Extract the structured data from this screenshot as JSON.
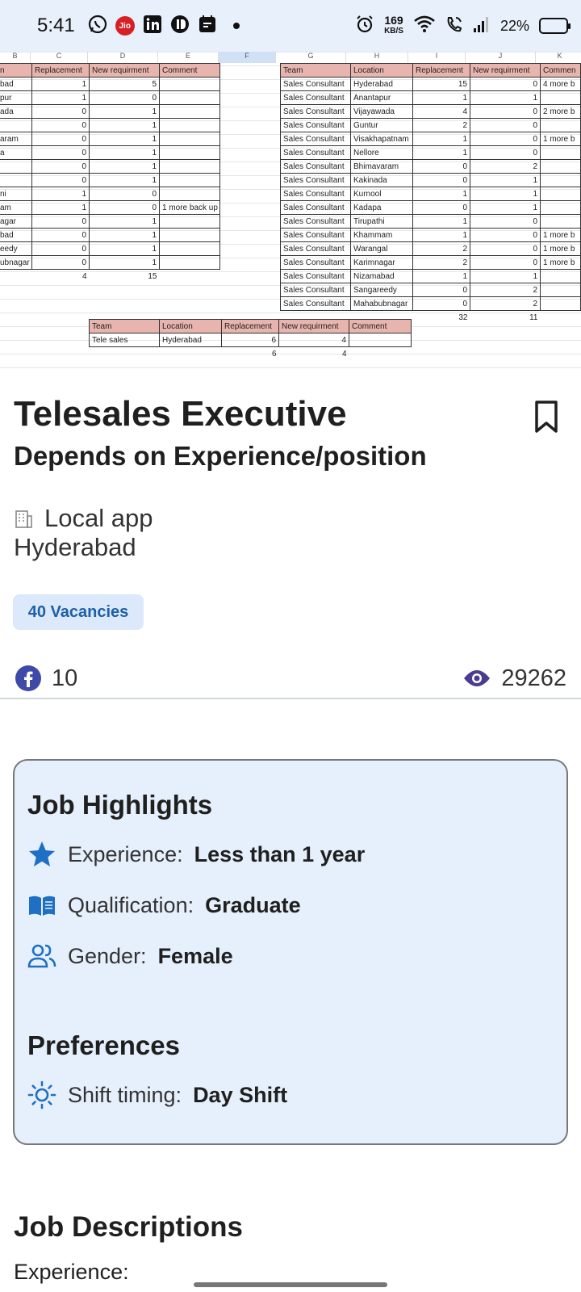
{
  "status_bar": {
    "time": "5:41",
    "jio_label": "Jio",
    "speed_value": "169",
    "speed_unit": "KB/S",
    "battery": "22%"
  },
  "sheet": {
    "col_letters_left": [
      "B",
      "C",
      "D",
      "E",
      "F"
    ],
    "col_letters_right": [
      "G",
      "H",
      "I",
      "J",
      "K"
    ],
    "left_table": {
      "headers": [
        "n",
        "Replacement",
        "New requirment",
        "Comment"
      ],
      "rows": [
        [
          "bad",
          "1",
          "5",
          ""
        ],
        [
          "pur",
          "1",
          "0",
          ""
        ],
        [
          "ada",
          "0",
          "1",
          ""
        ],
        [
          "",
          "0",
          "1",
          ""
        ],
        [
          "aram",
          "0",
          "1",
          ""
        ],
        [
          "a",
          "0",
          "1",
          ""
        ],
        [
          "",
          "0",
          "1",
          ""
        ],
        [
          "",
          "0",
          "1",
          ""
        ],
        [
          "ni",
          "1",
          "0",
          ""
        ],
        [
          "am",
          "1",
          "0",
          "1 more back up"
        ],
        [
          "agar",
          "0",
          "1",
          ""
        ],
        [
          "bad",
          "0",
          "1",
          ""
        ],
        [
          "eedy",
          "0",
          "1",
          ""
        ],
        [
          "ubnagar",
          "0",
          "1",
          ""
        ]
      ],
      "totals": [
        "",
        "4",
        "15",
        ""
      ]
    },
    "right_table": {
      "headers": [
        "Team",
        "Location",
        "Replacement",
        "New requirment",
        "Commen"
      ],
      "rows": [
        [
          "Sales Consultant",
          "Hyderabad",
          "15",
          "0",
          "4 more b"
        ],
        [
          "Sales Consultant",
          "Anantapur",
          "1",
          "1",
          ""
        ],
        [
          "Sales Consultant",
          "Vijayawada",
          "4",
          "0",
          "2 more b"
        ],
        [
          "Sales Consultant",
          "Guntur",
          "2",
          "0",
          ""
        ],
        [
          "Sales Consultant",
          "Visakhapatnam",
          "1",
          "0",
          "1 more b"
        ],
        [
          "Sales Consultant",
          "Nellore",
          "1",
          "0",
          ""
        ],
        [
          "Sales Consultant",
          "Bhimavaram",
          "0",
          "2",
          ""
        ],
        [
          "Sales Consultant",
          "Kakinada",
          "0",
          "1",
          ""
        ],
        [
          "Sales Consultant",
          "Kurnool",
          "1",
          "1",
          ""
        ],
        [
          "Sales Consultant",
          "Kadapa",
          "0",
          "1",
          ""
        ],
        [
          "Sales Consultant",
          "Tirupathi",
          "1",
          "0",
          ""
        ],
        [
          "Sales Consultant",
          "Khammam",
          "1",
          "0",
          "1 more b"
        ],
        [
          "Sales Consultant",
          "Warangal",
          "2",
          "0",
          "1 more b"
        ],
        [
          "Sales Consultant",
          "Karimnagar",
          "2",
          "0",
          "1 more b"
        ],
        [
          "Sales Consultant",
          "Nizamabad",
          "1",
          "1",
          ""
        ],
        [
          "Sales Consultant",
          "Sangareedy",
          "0",
          "2",
          ""
        ],
        [
          "Sales Consultant",
          "Mahabubnagar",
          "0",
          "2",
          ""
        ]
      ],
      "totals": [
        "",
        "",
        "32",
        "11",
        ""
      ]
    },
    "small_table": {
      "headers": [
        "Team",
        "Location",
        "Replacement",
        "New requirment",
        "Comment"
      ],
      "rows": [
        [
          "Tele sales",
          "Hyderabad",
          "6",
          "4",
          ""
        ]
      ],
      "totals": [
        "",
        "",
        "6",
        "4",
        ""
      ]
    }
  },
  "job": {
    "title": "Telesales Executive",
    "salary": "Depends on Experience/position",
    "company": "Local app",
    "location": "Hyderabad",
    "vacancies": "40 Vacancies",
    "shares": "10",
    "views": "29262"
  },
  "highlights": {
    "title": "Job Highlights",
    "items": [
      {
        "label": "Experience:",
        "value": "Less than 1 year",
        "icon": "star-icon"
      },
      {
        "label": "Qualification:",
        "value": "Graduate",
        "icon": "book-icon"
      },
      {
        "label": "Gender:",
        "value": "Female",
        "icon": "people-icon"
      }
    ],
    "preferences_title": "Preferences",
    "preferences": [
      {
        "label": "Shift timing:",
        "value": "Day Shift",
        "icon": "sun-icon"
      }
    ]
  },
  "descriptions": {
    "title": "Job Descriptions",
    "first_line": "Experience:"
  },
  "colors": {
    "accent": "#1f6fc5",
    "chip_bg": "#dbe9fb",
    "card_bg": "#e6f0fc",
    "sheet_header": "#e8b4ae"
  }
}
